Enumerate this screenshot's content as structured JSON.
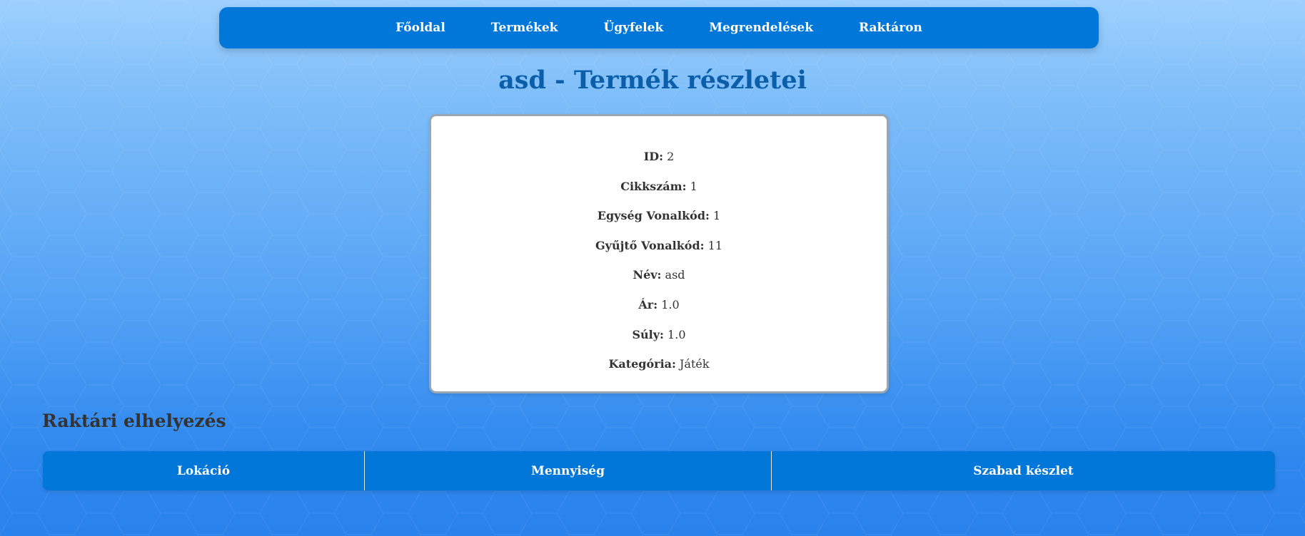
{
  "nav": {
    "items": [
      {
        "label": "Főoldal"
      },
      {
        "label": "Termékek"
      },
      {
        "label": "Ügyfelek"
      },
      {
        "label": "Megrendelések"
      },
      {
        "label": "Raktáron"
      }
    ]
  },
  "page": {
    "title": "asd - Termék részletei"
  },
  "product": {
    "fields": [
      {
        "label": "ID:",
        "value": "2"
      },
      {
        "label": "Cikkszám:",
        "value": "1"
      },
      {
        "label": "Egység Vonalkód:",
        "value": "1"
      },
      {
        "label": "Gyűjtő Vonalkód:",
        "value": "11"
      },
      {
        "label": "Név:",
        "value": "asd"
      },
      {
        "label": "Ár:",
        "value": "1.0"
      },
      {
        "label": "Súly:",
        "value": "1.0"
      },
      {
        "label": "Kategória:",
        "value": "Játék"
      }
    ]
  },
  "storage": {
    "title": "Raktári elhelyezés",
    "columns": [
      {
        "label": "Lokáció"
      },
      {
        "label": "Mennyiség"
      },
      {
        "label": "Szabad készlet"
      }
    ],
    "rows": []
  },
  "colors": {
    "primary": "#0077d9",
    "title": "#0a5eaa",
    "background_top": "#9dd0fd",
    "background_bottom": "#2a82ec"
  }
}
